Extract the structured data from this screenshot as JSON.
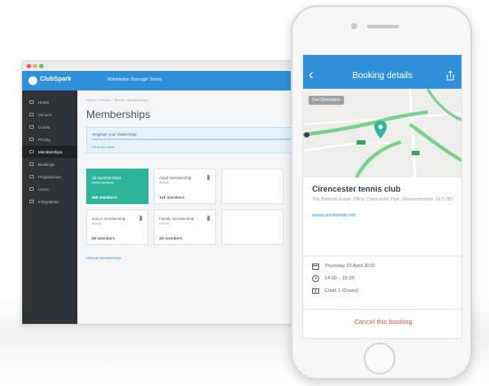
{
  "colors": {
    "brand_blue": "#2f8fd8",
    "sidebar": "#2e3338",
    "teal": "#2cb59a",
    "danger": "#e0524b"
  },
  "desktop": {
    "app_name": "ClubSpark",
    "org_selector": "Wimbledon Borough Tennis",
    "breadcrumb": "Home › Venues › Tennis › Memberships",
    "page_title": "Memberships",
    "sidebar_items": [
      {
        "label": "Home",
        "icon": "home-icon"
      },
      {
        "label": "Venues",
        "icon": "building-icon"
      },
      {
        "label": "Courts",
        "icon": "court-icon"
      },
      {
        "label": "Pricing",
        "icon": "tag-icon"
      },
      {
        "label": "Memberships",
        "icon": "people-icon",
        "active": true
      },
      {
        "label": "Bookings",
        "icon": "calendar-icon"
      },
      {
        "label": "Programmes",
        "icon": "list-icon"
      },
      {
        "label": "Users",
        "icon": "user-icon"
      },
      {
        "label": "Integrations",
        "icon": "plug-icon"
      }
    ],
    "notice": {
      "title": "Register your Ownership",
      "link": "Find out more"
    },
    "cards": [
      {
        "name": "All memberships",
        "sub": "Active members",
        "value": "368 members"
      },
      {
        "name": "Adult membership",
        "sub": "Annual",
        "value": "119 members"
      },
      {
        "name": "Junior membership",
        "sub": "Annual",
        "value": "46 members"
      },
      {
        "name": "Family membership",
        "sub": "Annual",
        "value": "45 members"
      }
    ],
    "view_all": "View all memberships"
  },
  "phone": {
    "nav_title": "Booking details",
    "map_button": "Get Directions",
    "venue_name": "Cirencester tennis club",
    "venue_address": "The Bathurst Estate Office, Cirencester Park, Gloucestershire, GL7 2BT",
    "venue_link": "www.cirentennis.net",
    "date": "Thursday 23 April 2015",
    "time": "14:00 – 15:00",
    "court": "Court 1 (Grass)",
    "cancel_label": "Cancel this booking"
  }
}
